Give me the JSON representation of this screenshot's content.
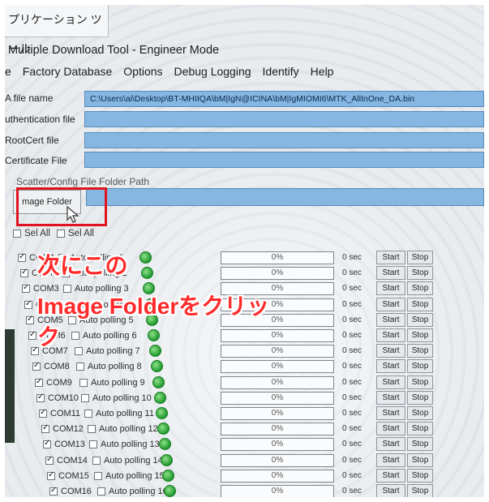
{
  "tab_title": "プリケーション ツール",
  "app_title": "Multiple Download Tool - Engineer Mode",
  "menu": [
    "e",
    "Factory Database",
    "Options",
    "Debug Logging",
    "Identify",
    "Help"
  ],
  "fields": [
    {
      "label": "A file name",
      "value": "C:\\Users\\ai\\Desktop\\BT-MHIIQA\\bM|IgN@ICINA\\bM|IgMIOMI6\\MTK_AllInOne_DA.bin"
    },
    {
      "label": "uthentication file",
      "value": ""
    },
    {
      "label": "RootCert file",
      "value": ""
    },
    {
      "label": "Certificate File",
      "value": ""
    }
  ],
  "scatter_label": "Scatter/Config File Folder Path",
  "image_folder_button": "mage Folder",
  "sel_all": "Sel All",
  "sel_all_2": "Sel All",
  "annotation_lines": [
    "次にこの",
    "Image Folderをクリッ",
    "ク"
  ],
  "ports": [
    {
      "com": "COM1",
      "auto": "Auto polling 1",
      "progress": "0%",
      "time": "0 sec",
      "start": "Start",
      "stop": "Stop"
    },
    {
      "com": "COM2",
      "auto": "Auto polling 2",
      "progress": "0%",
      "time": "0 sec",
      "start": "Start",
      "stop": "Stop"
    },
    {
      "com": "COM3",
      "auto": "Auto polling 3",
      "progress": "0%",
      "time": "0 sec",
      "start": "Start",
      "stop": "Stop"
    },
    {
      "com": "COM4",
      "auto": "Auto polling 4",
      "progress": "0%",
      "time": "0 sec",
      "start": "Start",
      "stop": "Stop"
    },
    {
      "com": "COM5",
      "auto": "Auto polling 5",
      "progress": "0%",
      "time": "0 sec",
      "start": "Start",
      "stop": "Stop"
    },
    {
      "com": "COM6",
      "auto": "Auto polling 6",
      "progress": "0%",
      "time": "0 sec",
      "start": "Start",
      "stop": "Stop"
    },
    {
      "com": "COM7",
      "auto": "Auto polling 7",
      "progress": "0%",
      "time": "0 sec",
      "start": "Start",
      "stop": "Stop"
    },
    {
      "com": "COM8",
      "auto": "Auto polling 8",
      "progress": "0%",
      "time": "0 sec",
      "start": "Start",
      "stop": "Stop"
    },
    {
      "com": "COM9",
      "auto": "Auto polling 9",
      "progress": "0%",
      "time": "0 sec",
      "start": "Start",
      "stop": "Stop"
    },
    {
      "com": "COM10",
      "auto": "Auto polling 10",
      "progress": "0%",
      "time": "0 sec",
      "start": "Start",
      "stop": "Stop"
    },
    {
      "com": "COM11",
      "auto": "Auto polling 11",
      "progress": "0%",
      "time": "0 sec",
      "start": "Start",
      "stop": "Stop"
    },
    {
      "com": "COM12",
      "auto": "Auto polling 12",
      "progress": "0%",
      "time": "0 sec",
      "start": "Start",
      "stop": "Stop"
    },
    {
      "com": "COM13",
      "auto": "Auto polling 13",
      "progress": "0%",
      "time": "0 sec",
      "start": "Start",
      "stop": "Stop"
    },
    {
      "com": "COM14",
      "auto": "Auto polling 14",
      "progress": "0%",
      "time": "0 sec",
      "start": "Start",
      "stop": "Stop"
    },
    {
      "com": "COM15",
      "auto": "Auto polling 15",
      "progress": "0%",
      "time": "0 sec",
      "start": "Start",
      "stop": "Stop"
    },
    {
      "com": "COM16",
      "auto": "Auto polling 16",
      "progress": "0%",
      "time": "0 sec",
      "start": "Start",
      "stop": "Stop"
    }
  ],
  "colors": {
    "field_blue": "#86b6e2",
    "annotation_red": "#ff2b2b",
    "highlight_box": "#e0141e",
    "led_green": "#1f9a2c"
  }
}
